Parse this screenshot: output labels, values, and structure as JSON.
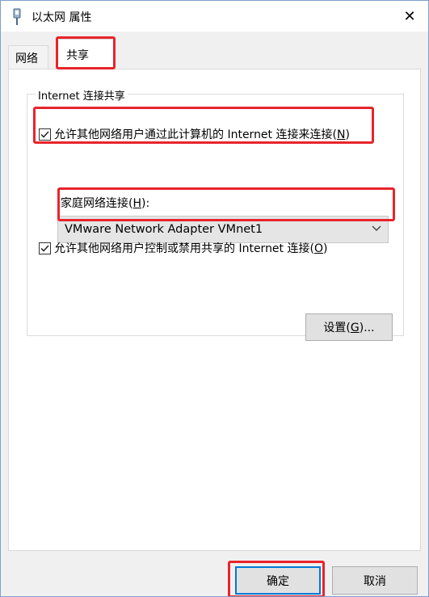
{
  "window": {
    "title": "以太网 属性",
    "close_label": "✕"
  },
  "tabs": [
    {
      "label": "网络"
    },
    {
      "label": "共享"
    }
  ],
  "sharing": {
    "group_title": "Internet 连接共享",
    "allow_share_label": "允许其他网络用户通过此计算机的 Internet 连接来连接(",
    "allow_share_key": "N",
    "allow_share_checked": true,
    "home_network_label": "家庭网络连接(",
    "home_network_key": "H",
    "home_network_value": "VMware Network Adapter VMnet1",
    "allow_control_label": "允许其他网络用户控制或禁用共享的 Internet 连接(",
    "allow_control_key": "O",
    "allow_control_checked": true,
    "settings_label": "设置(",
    "settings_key": "G"
  },
  "footer": {
    "ok_label": "确定",
    "cancel_label": "取消"
  },
  "colors": {
    "highlight": "#e8242b",
    "focus": "#0078d7"
  }
}
